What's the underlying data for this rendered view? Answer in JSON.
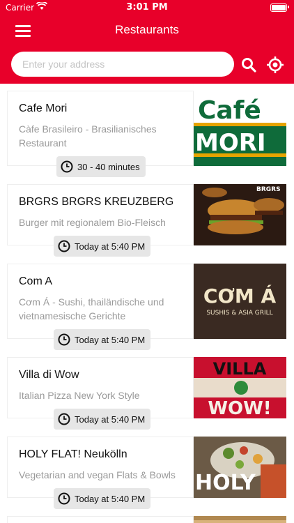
{
  "status_bar": {
    "carrier": "Carrier",
    "time": "3:01 PM"
  },
  "header": {
    "title": "Restaurants"
  },
  "search": {
    "placeholder": "Enter your address",
    "value": ""
  },
  "restaurants": [
    {
      "name": "Cafe Mori",
      "description": "Càfe Brasileiro - Brasilianisches Restaurant",
      "time": "30 - 40 minutes",
      "image_text": [
        "Café",
        "MORI"
      ]
    },
    {
      "name": "BRGRS BRGRS KREUZBERG",
      "description": "Burger mit regionalem Bio-Fleisch",
      "time": "Today at 5:40 PM",
      "image_text": [
        "BRGRS"
      ]
    },
    {
      "name": "Com A",
      "description": "Cơm Á - Sushi, thailändische und vietnamesische Gerichte",
      "time": "Today at 5:40 PM",
      "image_text": [
        "CƠM Á",
        "SUSHIS & ASIA GRILL"
      ]
    },
    {
      "name": "Villa di Wow",
      "description": "Italian Pizza New York Style",
      "time": "Today at 5:40 PM",
      "image_text": [
        "VILLA",
        "WOW!"
      ]
    },
    {
      "name": "HOLY FLAT! Neukölln",
      "description": "Vegetarian and vegan Flats & Bowls",
      "time": "Today at 5:40 PM",
      "image_text": [
        "HOLY"
      ]
    }
  ],
  "colors": {
    "brand_red": "#e8002a",
    "pill_bg": "#e6e6e6",
    "desc_gray": "#9a9a9a"
  },
  "icons": [
    "menu-icon",
    "search-icon",
    "location-target-icon",
    "clock-icon",
    "wifi-icon",
    "battery-icon"
  ]
}
